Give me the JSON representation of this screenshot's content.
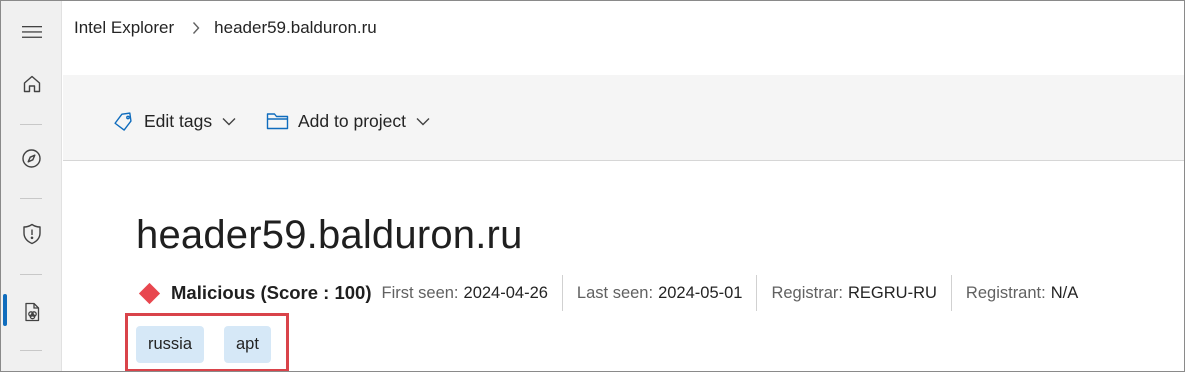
{
  "breadcrumb": {
    "root": "Intel Explorer",
    "current": "header59.balduron.ru"
  },
  "commands": {
    "edit_tags": "Edit tags",
    "add_to_project": "Add to project"
  },
  "entity": {
    "title": "header59.balduron.ru",
    "verdict": "Malicious (Score : 100)",
    "first_seen_label": "First seen:",
    "first_seen_value": "2024-04-26",
    "last_seen_label": "Last seen:",
    "last_seen_value": "2024-05-01",
    "registrar_label": "Registrar:",
    "registrar_value": "REGRU-RU",
    "registrant_label": "Registrant:",
    "registrant_value": "N/A",
    "tags": [
      "russia",
      "apt"
    ]
  },
  "colors": {
    "accent": "#0f6cbd",
    "malicious": "#e8474f",
    "tag_bg": "#d6e8f7",
    "highlight": "#d9434a"
  },
  "icons": {
    "rail": [
      "hamburger-icon",
      "home-icon",
      "compass-icon",
      "shield-alert-icon",
      "intel-document-icon"
    ],
    "commands": [
      "tag-icon",
      "folder-icon",
      "chevron-down-icon"
    ]
  }
}
